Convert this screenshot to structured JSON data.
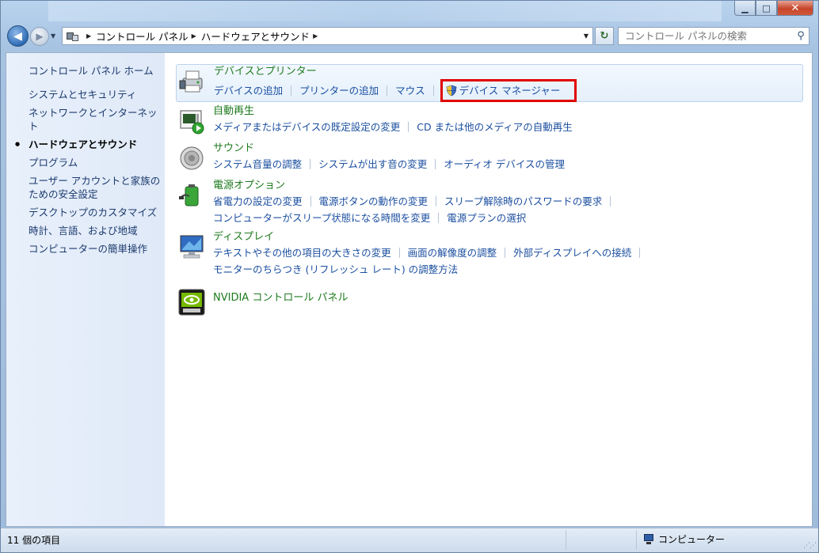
{
  "window": {
    "minimize_glyph": "▁",
    "maximize_glyph": "□",
    "close_glyph": "✕"
  },
  "nav": {
    "back_glyph": "◀",
    "forward_glyph": "▶",
    "breadcrumb": [
      "コントロール パネル",
      "ハードウェアとサウンド"
    ],
    "search_placeholder": "コントロール パネルの検索"
  },
  "sidebar": {
    "home": "コントロール パネル ホーム",
    "items": [
      {
        "label": "システムとセキュリティ"
      },
      {
        "label": "ネットワークとインターネット"
      },
      {
        "label": "ハードウェアとサウンド",
        "active": true
      },
      {
        "label": "プログラム"
      },
      {
        "label": "ユーザー アカウントと家族のための安全設定"
      },
      {
        "label": "デスクトップのカスタマイズ"
      },
      {
        "label": "時計、言語、および地域"
      },
      {
        "label": "コンピューターの簡単操作"
      }
    ]
  },
  "categories": {
    "devices": {
      "title": "デバイスとプリンター",
      "links": [
        "デバイスの追加",
        "プリンターの追加",
        "マウス",
        "デバイス マネージャー"
      ]
    },
    "autoplay": {
      "title": "自動再生",
      "links": [
        "メディアまたはデバイスの既定設定の変更",
        "CD または他のメディアの自動再生"
      ]
    },
    "sound": {
      "title": "サウンド",
      "links": [
        "システム音量の調整",
        "システムが出す音の変更",
        "オーディオ デバイスの管理"
      ]
    },
    "power": {
      "title": "電源オプション",
      "links": [
        "省電力の設定の変更",
        "電源ボタンの動作の変更",
        "スリープ解除時のパスワードの要求",
        "コンピューターがスリープ状態になる時間を変更",
        "電源プランの選択"
      ]
    },
    "display": {
      "title": "ディスプレイ",
      "links": [
        "テキストやその他の項目の大きさの変更",
        "画面の解像度の調整",
        "外部ディスプレイへの接続",
        "モニターのちらつき (リフレッシュ レート) の調整方法"
      ]
    },
    "nvidia": {
      "title": "NVIDIA コントロール パネル"
    }
  },
  "status": {
    "count": "11 個の項目",
    "location": "コンピューター"
  },
  "colors": {
    "highlight_border": "#e00000",
    "category_title": "#1e7a1e",
    "link": "#1c4fa0"
  }
}
